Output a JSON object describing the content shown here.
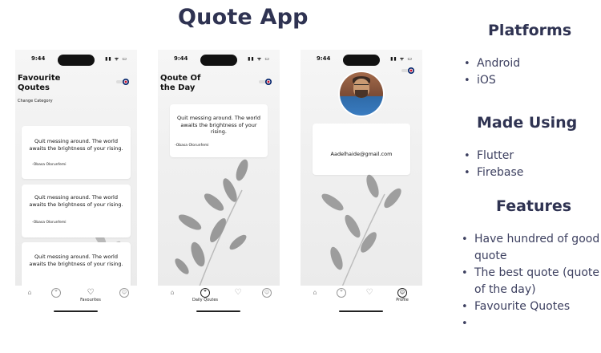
{
  "title": "Quote App",
  "phones": [
    {
      "time": "9:44",
      "heading_line1": "Favourite",
      "heading_line2": "Qoutes",
      "change_category": "Change Category",
      "cards": [
        {
          "text": "Quit messing around. The world awaits the brightness of your rising.",
          "author": "-Obasa Olorunfemi"
        },
        {
          "text": "Quit messing around. The world awaits the brightness of your rising.",
          "author": "-Obasa Olorunfemi"
        },
        {
          "text": "Quit messing around. The world awaits the brightness of your rising.",
          "author": ""
        }
      ],
      "active_tab_label": "Favourites"
    },
    {
      "time": "9:44",
      "heading_line1": "Qoute Of",
      "heading_line2": "the Day",
      "card": {
        "text": "Quit messing around. The world awaits the brightness of your rising.",
        "author": "-Obasa Olorunfemi"
      },
      "active_tab_label": "Daily Qoutes"
    },
    {
      "time": "9:44",
      "email": "Aadelhaide@gmail.com",
      "active_tab_label": "Profile"
    }
  ],
  "platforms": {
    "heading": "Platforms",
    "items": [
      "Android",
      "iOS"
    ]
  },
  "made_using": {
    "heading": "Made Using",
    "items": [
      "Flutter",
      "Firebase"
    ]
  },
  "features": {
    "heading": "Features",
    "items": [
      "Have hundred of good quote",
      "The best quote (quote of the day)",
      "Favourite Quotes",
      ""
    ]
  },
  "icons": [
    "home-icon",
    "quote-icon",
    "heart-icon",
    "profile-icon",
    "flag-icon"
  ]
}
